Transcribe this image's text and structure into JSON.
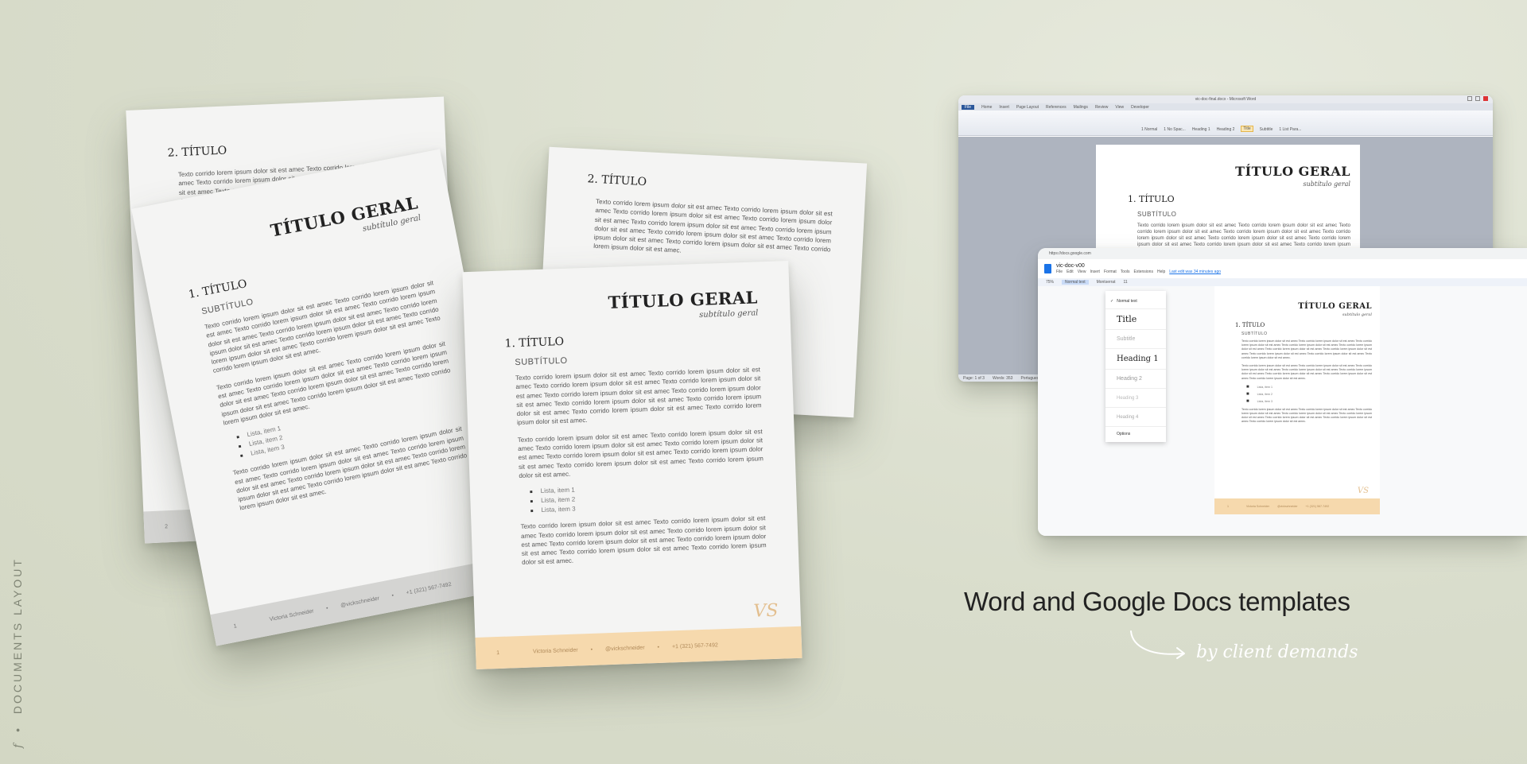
{
  "side_label": {
    "letter": "f",
    "dot": "•",
    "text": "DOCUMENTS LAYOUT"
  },
  "caption": "Word and Google Docs templates",
  "tagline": "by client demands",
  "colors": {
    "background": "#d9ddcc",
    "accent": "#f6d9ad",
    "monogram": "#e3bf8f",
    "footer_gray": "#d4d4d2",
    "word_blue": "#2b579a",
    "gdocs_blue": "#1a73e8"
  },
  "icons": [
    "monogram-icon",
    "bullet-icon",
    "curved-arrow-icon"
  ],
  "doc": {
    "title": "TÍTULO GERAL",
    "subtitle": "subtítulo geral",
    "h1": "1. TÍTULO",
    "h1b": "2. TÍTULO",
    "h2": "SUBTÍTULO",
    "para1": "Texto corrido lorem ipsum dolor sit est amec Texto corrido lorem ipsum dolor sit est amec Texto corrido lorem ipsum dolor sit est amec Texto corrido lorem ipsum dolor sit est amec Texto corrido lorem ipsum dolor sit est amec Texto corrido lorem ipsum dolor sit est amec Texto corrido lorem ipsum dolor sit est amec Texto corrido lorem ipsum dolor sit est amec Texto corrido lorem ipsum dolor sit est amec Texto corrido lorem ipsum dolor sit est amec.",
    "para2": "Texto corrido lorem ipsum dolor sit est amec Texto corrido lorem ipsum dolor sit est amec Texto corrido lorem ipsum dolor sit est amec Texto corrido lorem ipsum dolor sit est amec Texto corrido lorem ipsum dolor sit est amec Texto corrido lorem ipsum dolor sit est amec Texto corrido lorem ipsum dolor sit est amec Texto corrido lorem ipsum dolor sit est amec.",
    "list": [
      "Lista, item 1",
      "Lista, item 2",
      "Lista, item 3"
    ],
    "author": "Victoria Schneider",
    "handle": "@vickschneider",
    "phone": "+1 (321) 567-7492",
    "page1": "1",
    "page2": "2",
    "monogram": "VS"
  },
  "word": {
    "title_bar": "vic-doc-final.docx - Microsoft Word",
    "tabs": [
      "File",
      "Home",
      "Insert",
      "Page Layout",
      "References",
      "Mailings",
      "Review",
      "View",
      "Developer"
    ],
    "styles": [
      "1 Normal",
      "1 No Spac...",
      "Heading 1",
      "Heading 2",
      "Title",
      "Subtitle",
      "1 List Para..."
    ],
    "status": [
      "Page: 1 of 3",
      "Words: 353",
      "Portuguese (Brazil)"
    ]
  },
  "gdocs": {
    "url": "https://docs.google.com",
    "filename": "vic-doc-v00",
    "menus": [
      "File",
      "Edit",
      "View",
      "Insert",
      "Format",
      "Tools",
      "Extensions",
      "Help"
    ],
    "last_edit": "Last edit was 34 minutes ago",
    "style_select": "Normal text",
    "font_select": "Montserrat",
    "font_size": "11",
    "zoom": "75%",
    "styles": [
      {
        "label": "Normal text",
        "checked": true
      },
      {
        "label": "Title"
      },
      {
        "label": "Subtitle"
      },
      {
        "label": "Heading 1"
      },
      {
        "label": "Heading 2"
      },
      {
        "label": "Heading 3"
      },
      {
        "label": "Heading 4"
      },
      {
        "label": "Options"
      }
    ]
  }
}
